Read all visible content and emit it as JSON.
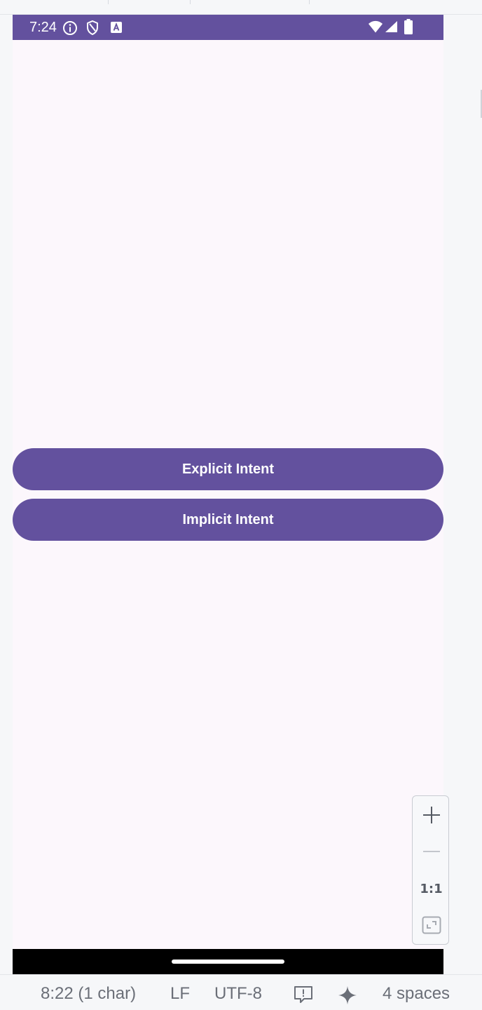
{
  "device": {
    "status_bar": {
      "time": "7:24",
      "left_icons": [
        "info-icon",
        "shield-icon",
        "a-square-icon"
      ],
      "right_icons": [
        "wifi-icon",
        "signal-icon",
        "battery-icon"
      ]
    },
    "buttons": {
      "explicit_label": "Explicit Intent",
      "implicit_label": "Implicit Intent"
    }
  },
  "zoom_controls": {
    "zoom_in_icon": "plus-icon",
    "zoom_out_icon": "minus-icon",
    "actual_size_label": "1:1",
    "fit_icon": "fit-screen-icon"
  },
  "ide_status": {
    "cursor_position": "8:22 (1 char)",
    "line_ending": "LF",
    "encoding": "UTF-8",
    "notifications_icon": "warning-message-icon",
    "ai_icon": "sparkle-icon",
    "indent": "4 spaces"
  },
  "colors": {
    "primary": "#63519e",
    "background": "#fcf7fc",
    "nav_bar": "#000000",
    "ide_background": "#f6f7f9"
  }
}
